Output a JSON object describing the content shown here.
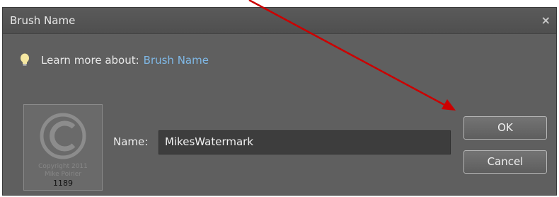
{
  "dialog": {
    "title": "Brush Name",
    "close_symbol": "×"
  },
  "learn_more": {
    "prefix": "Learn more about:",
    "link": "Brush Name",
    "icon": "lightbulb-icon"
  },
  "preview": {
    "line1": "Copyright 2011",
    "line2": "Mike Poirier",
    "size": "1189"
  },
  "name_field": {
    "label": "Name:",
    "value": "MikesWatermark"
  },
  "buttons": {
    "ok": "OK",
    "cancel": "Cancel"
  },
  "colors": {
    "dialog_bg": "#5f5f5f",
    "link": "#7fb8e6",
    "annotation_arrow": "#cc0000"
  }
}
